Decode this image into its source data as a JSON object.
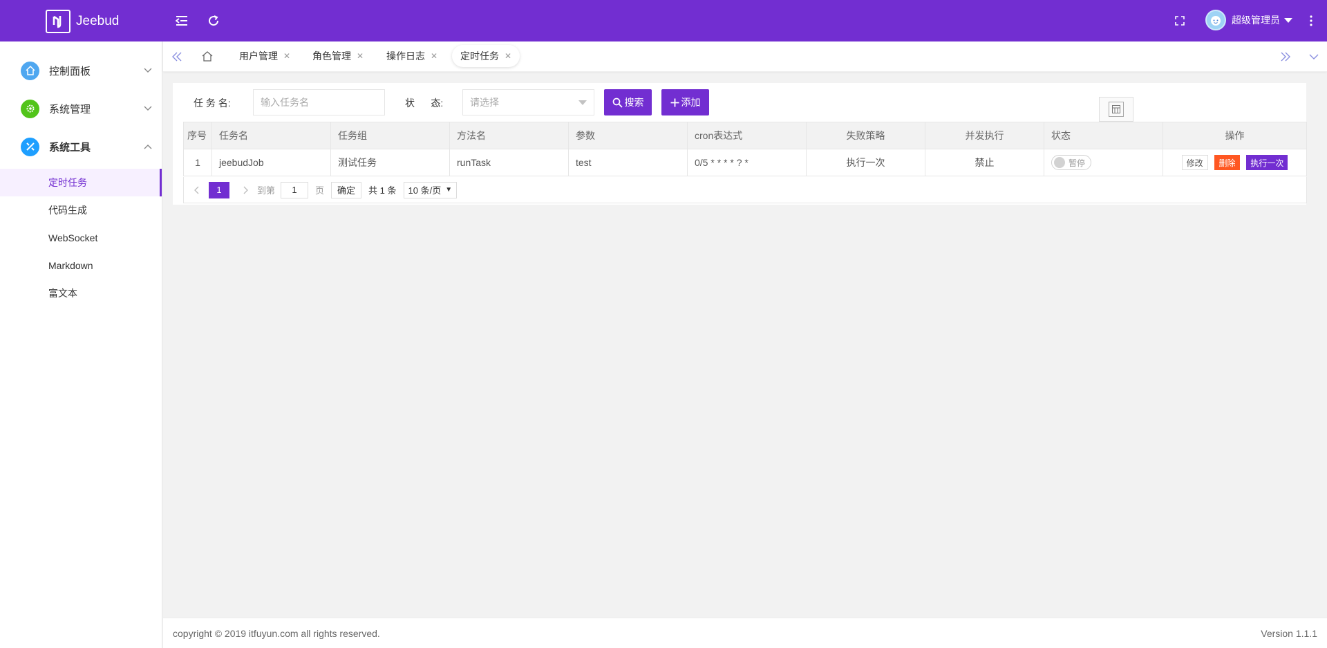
{
  "header": {
    "app_name": "Jeebud",
    "user_name": "超级管理员",
    "colors": {
      "brand": "#722ed1"
    },
    "icons": [
      "menu-fold-icon",
      "refresh-icon",
      "fullscreen-icon",
      "more-vertical-icon"
    ]
  },
  "sidebar": {
    "groups": [
      {
        "label": "控制面板",
        "icon": "home-icon",
        "color": "#4fa7f0"
      },
      {
        "label": "系统管理",
        "icon": "gear-icon",
        "color": "#52c41a"
      },
      {
        "label": "系统工具",
        "icon": "tools-icon",
        "color": "#1e9fff"
      }
    ],
    "sub_items": [
      "定时任务",
      "代码生成",
      "WebSocket",
      "Markdown",
      "富文本"
    ],
    "active_item": "定时任务"
  },
  "tabs": {
    "items": [
      "用户管理",
      "角色管理",
      "操作日志",
      "定时任务"
    ],
    "active": "定时任务"
  },
  "search": {
    "name_label": "任 务 名:",
    "name_placeholder": "输入任务名",
    "status_label": "状      态:",
    "status_placeholder": "请选择",
    "search_button": "搜索",
    "add_button": "添加"
  },
  "table": {
    "columns": [
      "序号",
      "任务名",
      "任务组",
      "方法名",
      "参数",
      "cron表达式",
      "失败策略",
      "并发执行",
      "状态",
      "操作"
    ],
    "rows": [
      {
        "index": "1",
        "name": "jeebudJob",
        "group": "测试任务",
        "method": "runTask",
        "params": "test",
        "cron": "0/5 * * * * ? *",
        "failure_policy": "执行一次",
        "concurrent": "禁止",
        "status": "暂停",
        "actions": [
          "修改",
          "删除",
          "执行一次"
        ]
      }
    ]
  },
  "pager": {
    "current": "1",
    "goto_label": "到第",
    "goto_value": "1",
    "page_unit": "页",
    "confirm": "确定",
    "total": "共 1 条",
    "page_size": "10 条/页"
  },
  "footer": {
    "copyright": "copyright © 2019 itfuyun.com all rights reserved.",
    "version": "Version 1.1.1"
  }
}
